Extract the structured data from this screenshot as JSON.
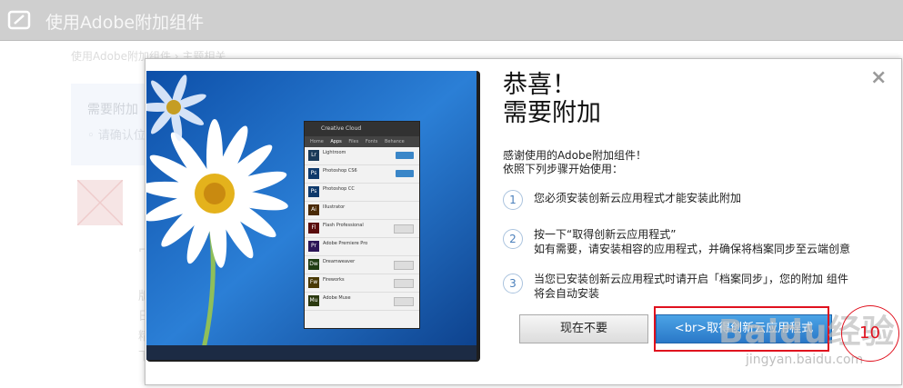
{
  "window": {
    "title": "使用Adobe附加组件"
  },
  "background": {
    "breadcrumb": "使用Adobe附加组件 › 主题相关",
    "panel_title": "需要附加",
    "panel_item": "◦ 请确认位",
    "frag1": "⌐",
    "frag2": "版",
    "frag3": "日",
    "frag4": "精",
    "frag5": "下"
  },
  "dialog": {
    "close_label": "×",
    "heading_line1": "恭喜！",
    "heading_line2": "需要附加",
    "intro_line1": "感谢使用的Adobe附加组件！",
    "intro_line2": "依照下列步骤开始使用：",
    "steps": [
      {
        "num": "1",
        "line1": "您必须安装创新云应用程式才能安装此附加",
        "line2": ""
      },
      {
        "num": "2",
        "line1": "按一下“取得创新云应用程式”",
        "line2": "如有需要，请安装相容的应用程式，并确保将档案同步至云端创意"
      },
      {
        "num": "3",
        "line1": "当您已安装创新云应用程式时请开启「档案同步」，您的附加 组件",
        "line2": "将会自动安装"
      }
    ],
    "btn_later": "现在不要",
    "btn_get": "<br>取得创新云应用程式"
  },
  "illustration": {
    "panel_title": "Creative Cloud",
    "tabs": [
      "Home",
      "Apps",
      "Files",
      "Fonts",
      "Behance"
    ],
    "apps": [
      {
        "abbr": "Lr",
        "name": "Lightroom",
        "color": "#1a3a58"
      },
      {
        "abbr": "Ps",
        "name": "Photoshop CS6",
        "color": "#0f3a6b"
      },
      {
        "abbr": "Ps",
        "name": "Photoshop CC",
        "color": "#0f3a6b"
      },
      {
        "abbr": "Ai",
        "name": "Illustrator",
        "color": "#4a2a06"
      },
      {
        "abbr": "Fl",
        "name": "Flash Professional",
        "color": "#5a0d0d"
      },
      {
        "abbr": "Pr",
        "name": "Adobe Premiere Pro",
        "color": "#2b1457"
      },
      {
        "abbr": "Dw",
        "name": "Dreamweaver",
        "color": "#1f3d14"
      },
      {
        "abbr": "Fw",
        "name": "Fireworks",
        "color": "#4a3a05"
      },
      {
        "abbr": "Mu",
        "name": "Adobe Muse",
        "color": "#2c3a10"
      }
    ]
  },
  "annotation": {
    "step_number": "10"
  },
  "watermark": {
    "main": "Baidu经验",
    "sub": "jingyan.baidu.com"
  },
  "colors": {
    "accent": "#2a78c8",
    "annotation": "#e0111e"
  }
}
